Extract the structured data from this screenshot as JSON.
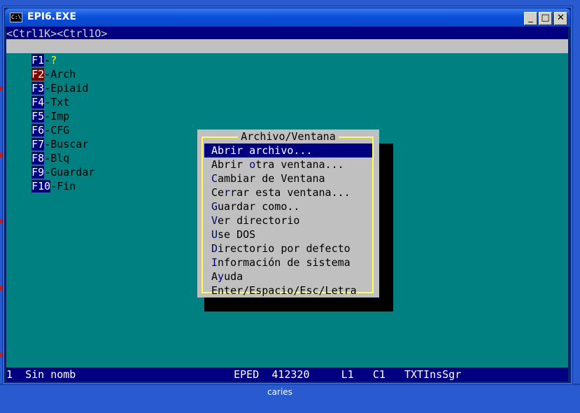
{
  "window": {
    "title": "EPI6.EXE",
    "icon": "console-icon",
    "buttons": [
      "minimize",
      "maximize",
      "close"
    ]
  },
  "console": {
    "ctrl_line": "<Ctrl1K><Ctrl1O>",
    "menu_keys": [
      {
        "key": "F1",
        "label": "-"
      },
      {
        "key": "F2",
        "label": "-Arch"
      },
      {
        "key": "F3",
        "label": "-Epiaid"
      },
      {
        "key": "F4",
        "label": "-Txt"
      },
      {
        "key": "F5",
        "label": "-Imp"
      },
      {
        "key": "F6",
        "label": "-CFG"
      },
      {
        "key": "F7",
        "label": "-Buscar"
      },
      {
        "key": "F8",
        "label": "-Blq"
      },
      {
        "key": "F9",
        "label": "-Guardar"
      },
      {
        "key": "F10",
        "label": "-Fin"
      }
    ],
    "f1_extra": "?",
    "status": {
      "window_num": "1",
      "file": "Sin nomb",
      "mode": "EPED",
      "memory": "412320",
      "line": "L1",
      "column": "C1",
      "flags": "TXTInsSgr"
    }
  },
  "dialog": {
    "title": "Archivo/Ventana",
    "items": [
      {
        "pre": "",
        "hot": "A",
        "post": "brir archivo...",
        "selected": true
      },
      {
        "pre": "Abrir ",
        "hot": "o",
        "post": "tra ventana...",
        "selected": false
      },
      {
        "pre": "",
        "hot": "C",
        "post": "ambiar de Ventana",
        "selected": false
      },
      {
        "pre": "Ce",
        "hot": "r",
        "post": "rar esta ventana...",
        "selected": false
      },
      {
        "pre": "",
        "hot": "G",
        "post": "uardar como..",
        "selected": false
      },
      {
        "pre": "",
        "hot": "V",
        "post": "er directorio",
        "selected": false
      },
      {
        "pre": "",
        "hot": "U",
        "post": "se DOS",
        "selected": false
      },
      {
        "pre": "",
        "hot": "D",
        "post": "irectorio por defecto",
        "selected": false
      },
      {
        "pre": "",
        "hot": "I",
        "post": "nformación de sistema",
        "selected": false
      },
      {
        "pre": "A",
        "hot": "y",
        "post": "uda",
        "selected": false
      }
    ],
    "help": "Enter/Espacio/Esc/Letra"
  },
  "desktop": {
    "caption": "caries"
  },
  "colors": {
    "console_bg": "#008080",
    "bar_bg": "#000080",
    "menu_bg": "#c0c0c0",
    "dialog_border": "#ffff55",
    "f2_key_bg": "#800000"
  }
}
